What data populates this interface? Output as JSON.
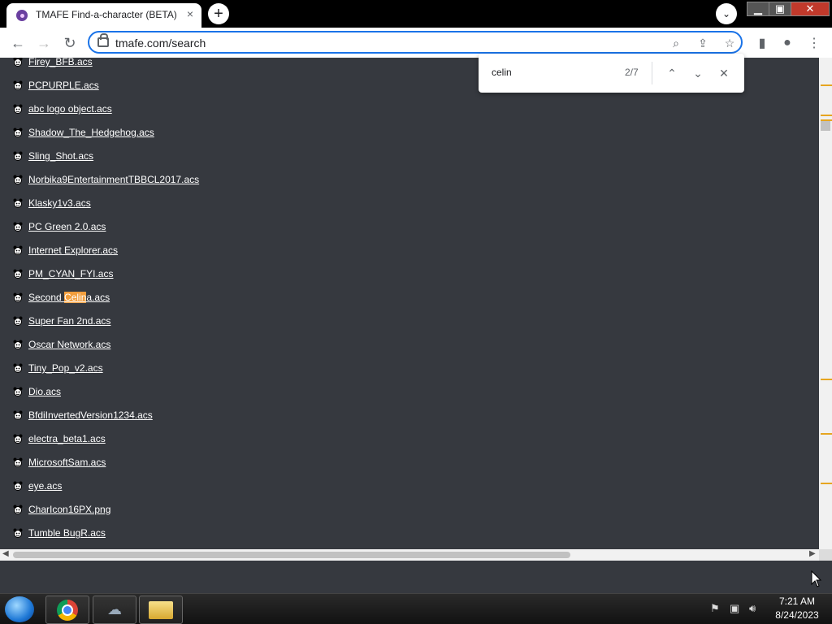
{
  "browser": {
    "tab": {
      "title": "TMAFE Find-a-character (BETA)",
      "close": "×"
    },
    "new_tab": "+",
    "tab_search": "⌄",
    "window_controls": {
      "minimize": "▁",
      "maximize": "▣",
      "close": "✕"
    },
    "url": "tmafe.com/search"
  },
  "find_bar": {
    "query": "celin",
    "count": "2/7"
  },
  "results": [
    {
      "pre": "Firey_BFB.acs",
      "match": "",
      "post": ""
    },
    {
      "pre": "PCPURPLE.acs",
      "match": "",
      "post": ""
    },
    {
      "pre": "abc logo object.acs",
      "match": "",
      "post": ""
    },
    {
      "pre": "Shadow_The_Hedgehog.acs",
      "match": "",
      "post": ""
    },
    {
      "pre": "Sling_Shot.acs",
      "match": "",
      "post": ""
    },
    {
      "pre": "Norbika9EntertainmentTBBCL2017.acs",
      "match": "",
      "post": ""
    },
    {
      "pre": "Klasky1v3.acs",
      "match": "",
      "post": ""
    },
    {
      "pre": "PC Green 2.0.acs",
      "match": "",
      "post": ""
    },
    {
      "pre": "Internet Explorer.acs",
      "match": "",
      "post": ""
    },
    {
      "pre": "PM_CYAN_FYI.acs",
      "match": "",
      "post": ""
    },
    {
      "pre": "Second ",
      "match": "Celin",
      "post": "a.acs"
    },
    {
      "pre": "Super Fan 2nd.acs",
      "match": "",
      "post": ""
    },
    {
      "pre": "Oscar Network.acs",
      "match": "",
      "post": ""
    },
    {
      "pre": "Tiny_Pop_v2.acs",
      "match": "",
      "post": ""
    },
    {
      "pre": "Dio.acs",
      "match": "",
      "post": ""
    },
    {
      "pre": "BfdiInvertedVersion1234.acs",
      "match": "",
      "post": ""
    },
    {
      "pre": "electra_beta1.acs",
      "match": "",
      "post": ""
    },
    {
      "pre": "MicrosoftSam.acs",
      "match": "",
      "post": ""
    },
    {
      "pre": "eye.acs",
      "match": "",
      "post": ""
    },
    {
      "pre": "CharIcon16PX.png",
      "match": "",
      "post": ""
    },
    {
      "pre": "Tumble BugR.acs",
      "match": "",
      "post": ""
    }
  ],
  "taskbar": {
    "time": "7:21 AM",
    "date": "8/24/2023"
  },
  "colors": {
    "highlight": "#f29e3d",
    "page_bg": "#36393f",
    "accent": "#1a73e8"
  }
}
